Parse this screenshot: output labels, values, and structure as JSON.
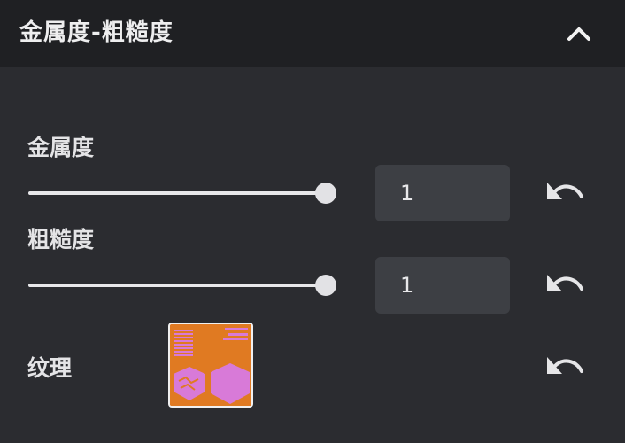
{
  "panel": {
    "title": "金属度-粗糙度",
    "collapse_icon": "chevron-up-icon"
  },
  "metallic": {
    "label": "金属度",
    "value": "1",
    "slider_fraction": 1,
    "reset_icon": "undo-icon"
  },
  "roughness": {
    "label": "粗糙度",
    "value": "1",
    "slider_fraction": 1,
    "reset_icon": "undo-icon"
  },
  "texture": {
    "label": "纹理",
    "thumbnail_icon": "texture-thumbnail",
    "reset_icon": "undo-icon"
  },
  "colors": {
    "header_bg": "#1f2023",
    "panel_bg": "#2b2c30",
    "input_bg": "#3d3f44",
    "texture_orange": "#e07a22",
    "texture_pink": "#d87ad8"
  }
}
